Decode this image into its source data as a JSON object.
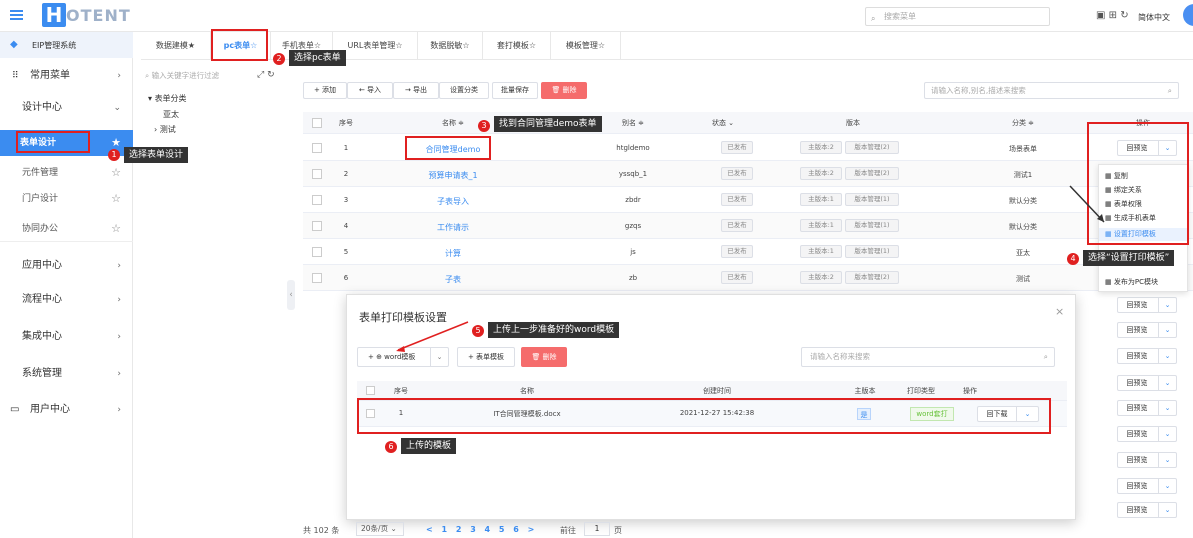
{
  "header": {
    "logo_letter": "H",
    "logo_text": "OTENT",
    "search_placeholder": "搜索菜单",
    "icons": [
      "window-icon",
      "grid-icon",
      "refresh-icon"
    ],
    "lang": "简体中文"
  },
  "sidebar": {
    "system": "EIP管理系统",
    "common_menu": "常用菜单",
    "design_center": "设计中心",
    "items": [
      {
        "label": "表单设计",
        "active": true
      },
      {
        "label": "元件管理"
      },
      {
        "label": "门户设计"
      },
      {
        "label": "协同办公"
      }
    ],
    "groups": [
      "应用中心",
      "流程中心",
      "集成中心",
      "系统管理",
      "用户中心"
    ]
  },
  "tabs": [
    "数据建模★",
    "pc表单☆",
    "手机表单☆",
    "URL表单管理☆",
    "数据脱敏☆",
    "套打模板☆",
    "模板管理☆"
  ],
  "tree": {
    "search_placeholder": "输入关键字进行过滤",
    "root": "表单分类",
    "children": [
      "亚太",
      "测试"
    ]
  },
  "toolbar": {
    "add": "+ 添加",
    "import": "← 导入",
    "export": "→ 导出",
    "category": "设置分类",
    "batch_save": "批量保存",
    "delete": "删除",
    "search_placeholder": "请输入名称,别名,描述来搜索"
  },
  "grid": {
    "headers": {
      "index": "序号",
      "name": "名称 ≑",
      "alias": "别名 ≑",
      "status": "状态 ⌄",
      "version": "版本",
      "category": "分类 ≑",
      "ops": "操作"
    },
    "rows": [
      {
        "index": "1",
        "name": "合同管理demo",
        "alias": "htgldemo",
        "status": "已发布",
        "main": "主版本:2",
        "ver": "版本管理(2)",
        "category": "场景表单"
      },
      {
        "index": "2",
        "name": "预算申请表_1",
        "alias": "yssqb_1",
        "status": "已发布",
        "main": "主版本:2",
        "ver": "版本管理(2)",
        "category": "测试1"
      },
      {
        "index": "3",
        "name": "子表导入",
        "alias": "zbdr",
        "status": "已发布",
        "main": "主版本:1",
        "ver": "版本管理(1)",
        "category": "默认分类"
      },
      {
        "index": "4",
        "name": "工作请示",
        "alias": "gzqs",
        "status": "已发布",
        "main": "主版本:1",
        "ver": "版本管理(1)",
        "category": "默认分类"
      },
      {
        "index": "5",
        "name": "计算",
        "alias": "js",
        "status": "已发布",
        "main": "主版本:1",
        "ver": "版本管理(1)",
        "category": "亚太"
      },
      {
        "index": "6",
        "name": "子表",
        "alias": "zb",
        "status": "已发布",
        "main": "主版本:2",
        "ver": "版本管理(2)",
        "category": "测试"
      }
    ],
    "preview": "回预览"
  },
  "menu": {
    "items": [
      "复制",
      "绑定关系",
      "表单权限",
      "生成手机表单",
      "设置打印模板",
      "发布为PC模块"
    ]
  },
  "dialog": {
    "title": "表单打印模板设置",
    "word_btn": "+ ⊕ word模板",
    "form_btn": "+ 表单模板",
    "delete": "删除",
    "search_placeholder": "请输入名称来搜索",
    "headers": {
      "index": "序号",
      "name": "名称",
      "time": "创建时间",
      "main": "主版本",
      "type": "打印类型",
      "ops": "操作"
    },
    "row": {
      "index": "1",
      "name": "IT合同管理模板.docx",
      "time": "2021-12-27 15:42:38",
      "main": "是",
      "type": "word套打",
      "download": "回下载"
    }
  },
  "pager": {
    "total": "共 102 条",
    "size": "20条/页",
    "pages": "< 1 2 3 4 5 6 >",
    "goto": "前往",
    "page": "1",
    "unit": "页"
  },
  "callouts": [
    {
      "n": "1",
      "text": "选择表单设计"
    },
    {
      "n": "2",
      "text": "选择pc表单"
    },
    {
      "n": "3",
      "text": "找到合同管理demo表单"
    },
    {
      "n": "4",
      "text": "选择“设置打印模板”"
    },
    {
      "n": "5",
      "text": "上传上一步准备好的word模板"
    },
    {
      "n": "6",
      "text": "上传的模板"
    }
  ]
}
